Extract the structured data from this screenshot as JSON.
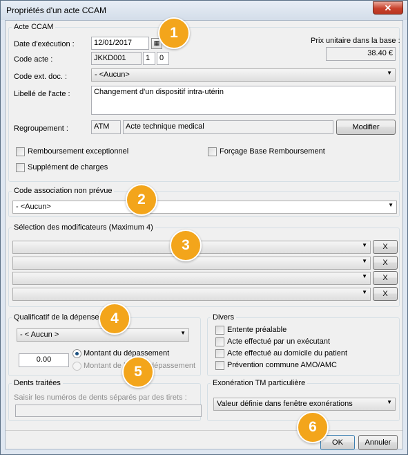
{
  "window": {
    "title": "Propriétés d'un acte CCAM",
    "close_glyph": "✕"
  },
  "acte": {
    "group_label": "Acte CCAM",
    "date_label": "Date d'exécution :",
    "date_value": "12/01/2017",
    "calendar_icon": "calendar-icon",
    "code_label": "Code acte :",
    "code_value": "JKKD001",
    "code_part2": "1",
    "code_part3": "0",
    "prix_label": "Prix unitaire dans la base :",
    "prix_value": "38.40 €",
    "code_ext_label": "Code ext. doc. :",
    "code_ext_value": "- <Aucun>",
    "libelle_label": "Libellé de l'acte :",
    "libelle_value": "Changement d'un dispositif intra-utérin",
    "regroupement_label": "Regroupement :",
    "regroupement_code": "ATM",
    "regroupement_value": "Acte technique medical",
    "modifier_label": "Modifier",
    "remb_exc_label": "Remboursement exceptionnel",
    "forcage_label": "Forçage Base Remboursement",
    "supplement_label": "Supplément de charges"
  },
  "association": {
    "group_label": "Code association non prévue",
    "value": "- <Aucun>"
  },
  "modificateurs": {
    "group_label": "Sélection des modificateurs (Maximum 4)",
    "items": [
      {
        "value": "",
        "clear_label": "X"
      },
      {
        "value": "",
        "clear_label": "X"
      },
      {
        "value": "",
        "clear_label": "X"
      },
      {
        "value": "",
        "clear_label": "X"
      }
    ]
  },
  "qualificatif": {
    "group_label": "Qualificatif de la dépense",
    "value": "- < Aucun >",
    "montant_value": "0.00",
    "radio1_label": "Montant du dépassement",
    "radio2_label": "Montant de l'acte + dépassement"
  },
  "divers": {
    "group_label": "Divers",
    "items": [
      {
        "label": "Entente préalable"
      },
      {
        "label": "Acte effectué par un exécutant"
      },
      {
        "label": "Acte effectué au domicile du patient"
      },
      {
        "label": "Prévention commune AMO/AMC"
      }
    ]
  },
  "dents": {
    "group_label": "Dents traitées",
    "hint": "Saisir les numéros de dents séparés par des tirets :",
    "value": ""
  },
  "exoneration": {
    "group_label": "Exonération TM particulière",
    "value": "Valeur définie dans fenêtre exonérations"
  },
  "footer": {
    "ok_label": "OK",
    "cancel_label": "Annuler"
  },
  "badges": [
    "1",
    "2",
    "3",
    "4",
    "5",
    "6"
  ],
  "colors": {
    "badge": "#f3a51b",
    "close_button": "#c7412b"
  }
}
